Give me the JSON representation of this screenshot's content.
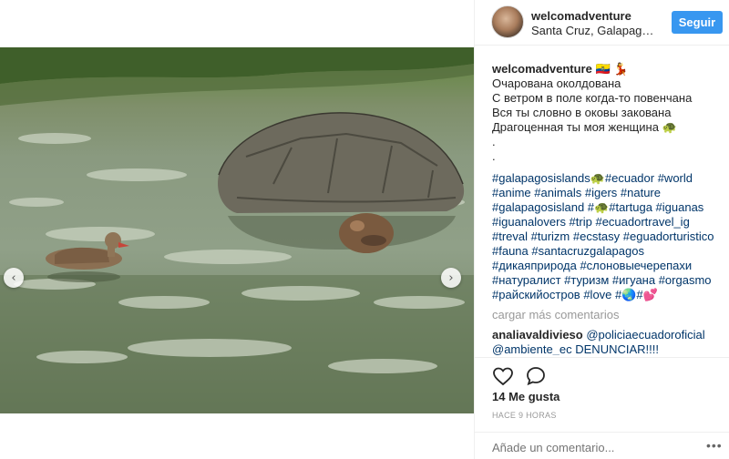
{
  "header": {
    "username": "welcomadventure",
    "location": "Santa Cruz, Galapagos Islands",
    "follow_label": "Seguir"
  },
  "caption": {
    "username": "welcomadventure",
    "emoji": "🇪🇨 💃",
    "lines": [
      "Очарована околдована",
      "С ветром в поле когда-то повенчана",
      "Вся ты словно в оковы закована",
      "Драгоценная ты моя женщина 🐢",
      ".",
      "."
    ],
    "hashtag_lines": [
      "#galapagosislands🐢#ecuador #world",
      "#anime #animals #igers #nature",
      "#galapagosisland #🐢#tartuga #iguanas",
      "#iguanalovers #trip #ecuadortravel_ig",
      "#treval #turizm #ecstasy #eguadorturistico",
      "#fauna #santacruzgalapagos",
      "#дикаяприрода #слоновыечерепахи",
      "#натуралист #туризм #игуана #orgasmo",
      "#райскийостров #love #🌏#💕"
    ]
  },
  "load_more": "cargar más comentarios",
  "comment": {
    "username": "analiavaldivieso",
    "text": "@policiaecuadoroficial @ambiente_ec DENUNCIAR!!!!"
  },
  "likes": "14 Me gusta",
  "time": "HACE 9 HORAS",
  "add_comment_placeholder": "Añade un comentario...",
  "more_options": "•••",
  "icons": {
    "prev": "chevron-left-icon",
    "next": "chevron-right-icon",
    "like": "heart-icon",
    "comment": "comment-icon"
  }
}
